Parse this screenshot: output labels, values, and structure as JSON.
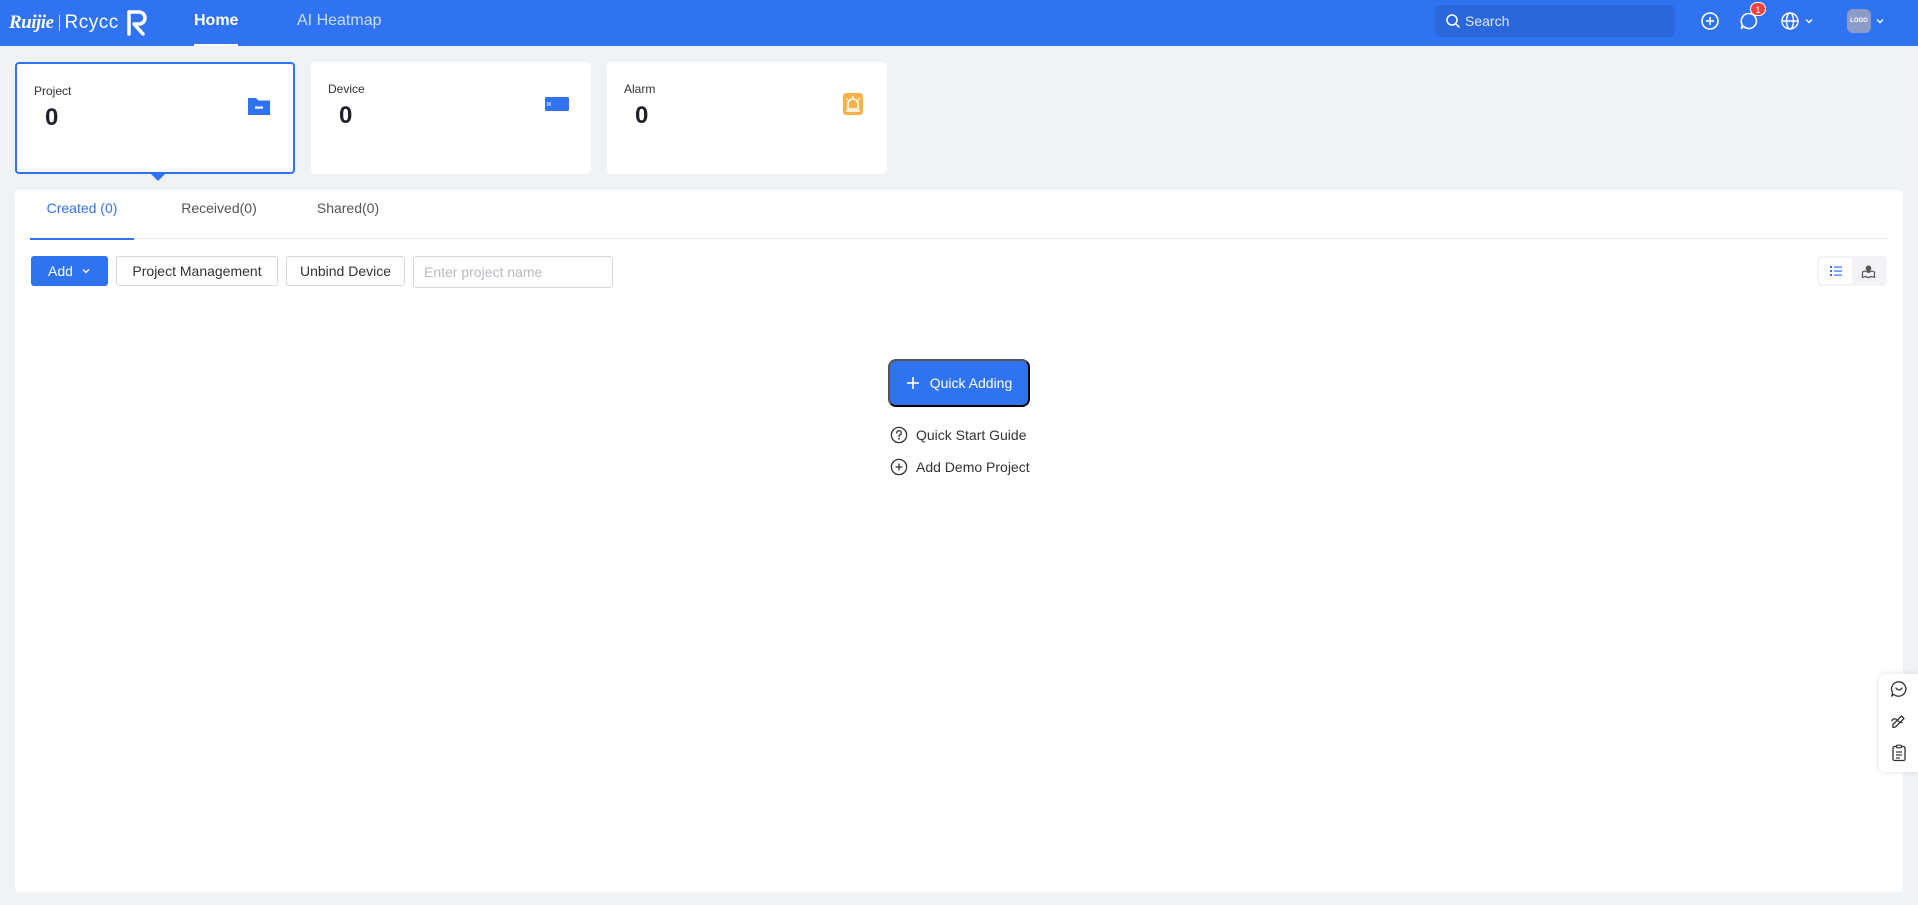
{
  "header": {
    "brand_ruijie": "Ruijie",
    "brand_reyee": "Rcycc",
    "nav": [
      "Home",
      "AI Heatmap"
    ],
    "active_nav": "Home",
    "search_placeholder": "Search",
    "notification_count": "1",
    "avatar_text": "LOGO",
    "icons": [
      "add-circle-icon",
      "message-icon",
      "globe-icon",
      "chevron-down-icon"
    ]
  },
  "cards": [
    {
      "label": "Project",
      "value": "0",
      "icon": "folder-icon",
      "color": "#2f73f2",
      "selected": true
    },
    {
      "label": "Device",
      "value": "0",
      "icon": "device-icon",
      "color": "#2f73f2",
      "selected": false
    },
    {
      "label": "Alarm",
      "value": "0",
      "icon": "alarm-icon",
      "color": "#f7b24a",
      "selected": false
    }
  ],
  "tabs": [
    "Created (0)",
    "Received(0)",
    "Shared(0)"
  ],
  "active_tab": "Created (0)",
  "toolbar": {
    "add_label": "Add",
    "project_management_label": "Project Management",
    "unbind_device_label": "Unbind Device",
    "search_placeholder": "Enter project name",
    "view_modes": [
      "list-view-icon",
      "map-view-icon"
    ],
    "active_view": "list-view-icon"
  },
  "empty_state": {
    "quick_adding_label": "Quick Adding",
    "quick_start_label": "Quick Start Guide",
    "demo_project_label": "Add Demo Project"
  },
  "float_toolbar": [
    "chat-support-icon",
    "feedback-pen-icon",
    "notes-icon"
  ],
  "colors": {
    "primary": "#2f73f2",
    "background": "#eff3f6",
    "alarm": "#f7b24a",
    "badge": "#f5413d"
  }
}
